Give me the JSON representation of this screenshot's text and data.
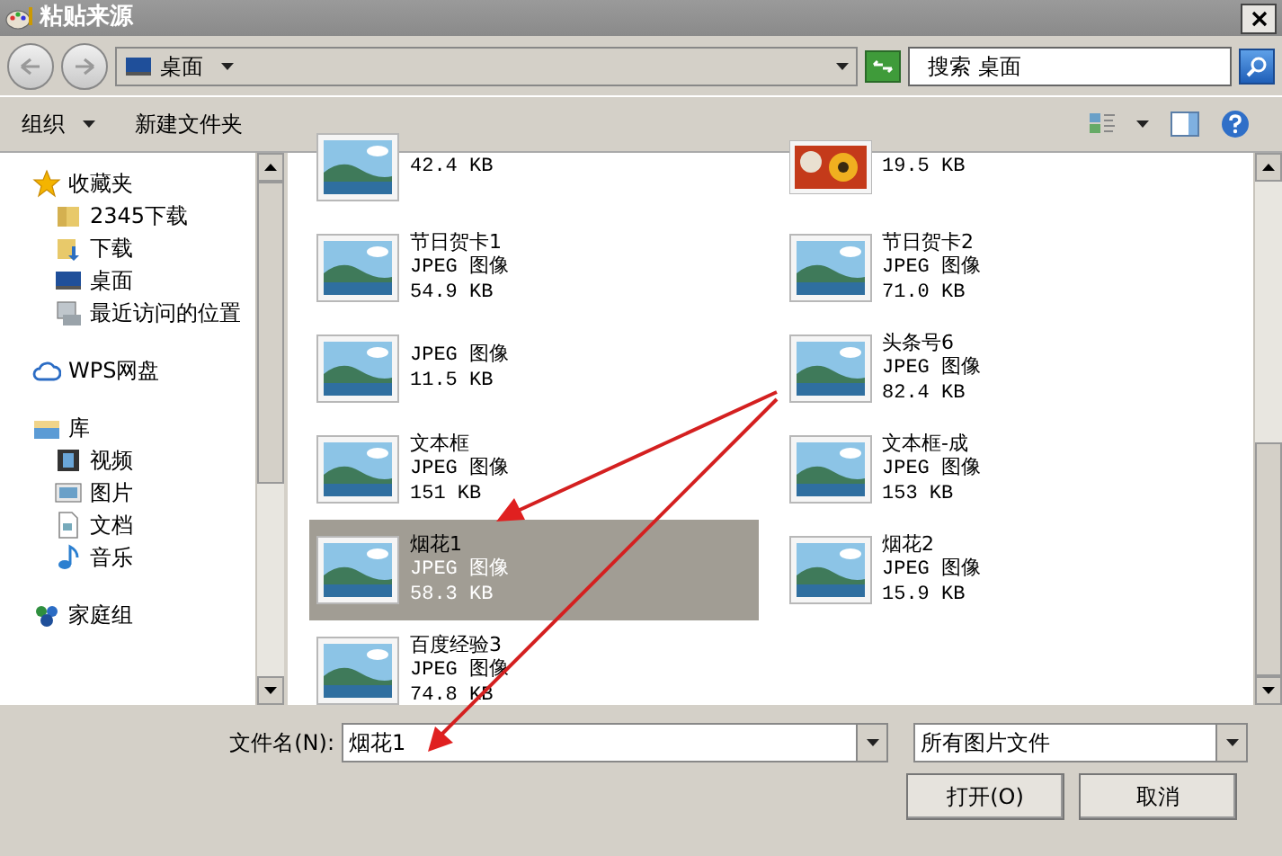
{
  "window": {
    "title": "粘贴来源"
  },
  "address": {
    "location": "桌面",
    "search_placeholder": "搜索 桌面"
  },
  "toolbar": {
    "organize": "组织",
    "new_folder": "新建文件夹"
  },
  "sidebar": {
    "items": [
      {
        "label": "收藏夹",
        "kind": "star",
        "children": [
          {
            "label": "2345下载",
            "kind": "folder"
          },
          {
            "label": "下载",
            "kind": "download"
          },
          {
            "label": "桌面",
            "kind": "desktop"
          },
          {
            "label": "最近访问的位置",
            "kind": "recent"
          }
        ]
      },
      {
        "label": "WPS网盘",
        "kind": "cloud"
      },
      {
        "label": "库",
        "kind": "library",
        "children": [
          {
            "label": "视频",
            "kind": "video"
          },
          {
            "label": "图片",
            "kind": "picture"
          },
          {
            "label": "文档",
            "kind": "document"
          },
          {
            "label": "音乐",
            "kind": "music"
          }
        ]
      },
      {
        "label": "家庭组",
        "kind": "homegroup"
      }
    ]
  },
  "files": [
    {
      "size": "42.4 KB",
      "kind": "landscape",
      "selected": false
    },
    {
      "size": "19.5 KB",
      "kind": "flowers",
      "selected": false
    },
    {
      "name": "节日贺卡1",
      "type": "JPEG 图像",
      "size": "54.9 KB",
      "kind": "landscape",
      "selected": false
    },
    {
      "name": "节日贺卡2",
      "type": "JPEG 图像",
      "size": "71.0 KB",
      "kind": "landscape",
      "selected": false
    },
    {
      "type": "JPEG 图像",
      "size": "11.5 KB",
      "kind": "landscape",
      "selected": false
    },
    {
      "name": "头条号6",
      "type": "JPEG 图像",
      "size": "82.4 KB",
      "kind": "landscape",
      "selected": false
    },
    {
      "name": "文本框",
      "type": "JPEG 图像",
      "size": "151 KB",
      "kind": "landscape",
      "selected": false
    },
    {
      "name": "文本框-成",
      "type": "JPEG 图像",
      "size": "153 KB",
      "kind": "landscape",
      "selected": false
    },
    {
      "name": "烟花1",
      "type": "JPEG 图像",
      "size": "58.3 KB",
      "kind": "landscape",
      "selected": true
    },
    {
      "name": "烟花2",
      "type": "JPEG 图像",
      "size": "15.9 KB",
      "kind": "landscape",
      "selected": false
    },
    {
      "name": "百度经验3",
      "type": "JPEG 图像",
      "size": "74.8 KB",
      "kind": "landscape",
      "selected": false
    }
  ],
  "footer": {
    "filename_label": "文件名(N):",
    "filename": "烟花1",
    "filter": "所有图片文件",
    "buttons": [
      "打开(O)",
      "取消"
    ]
  }
}
